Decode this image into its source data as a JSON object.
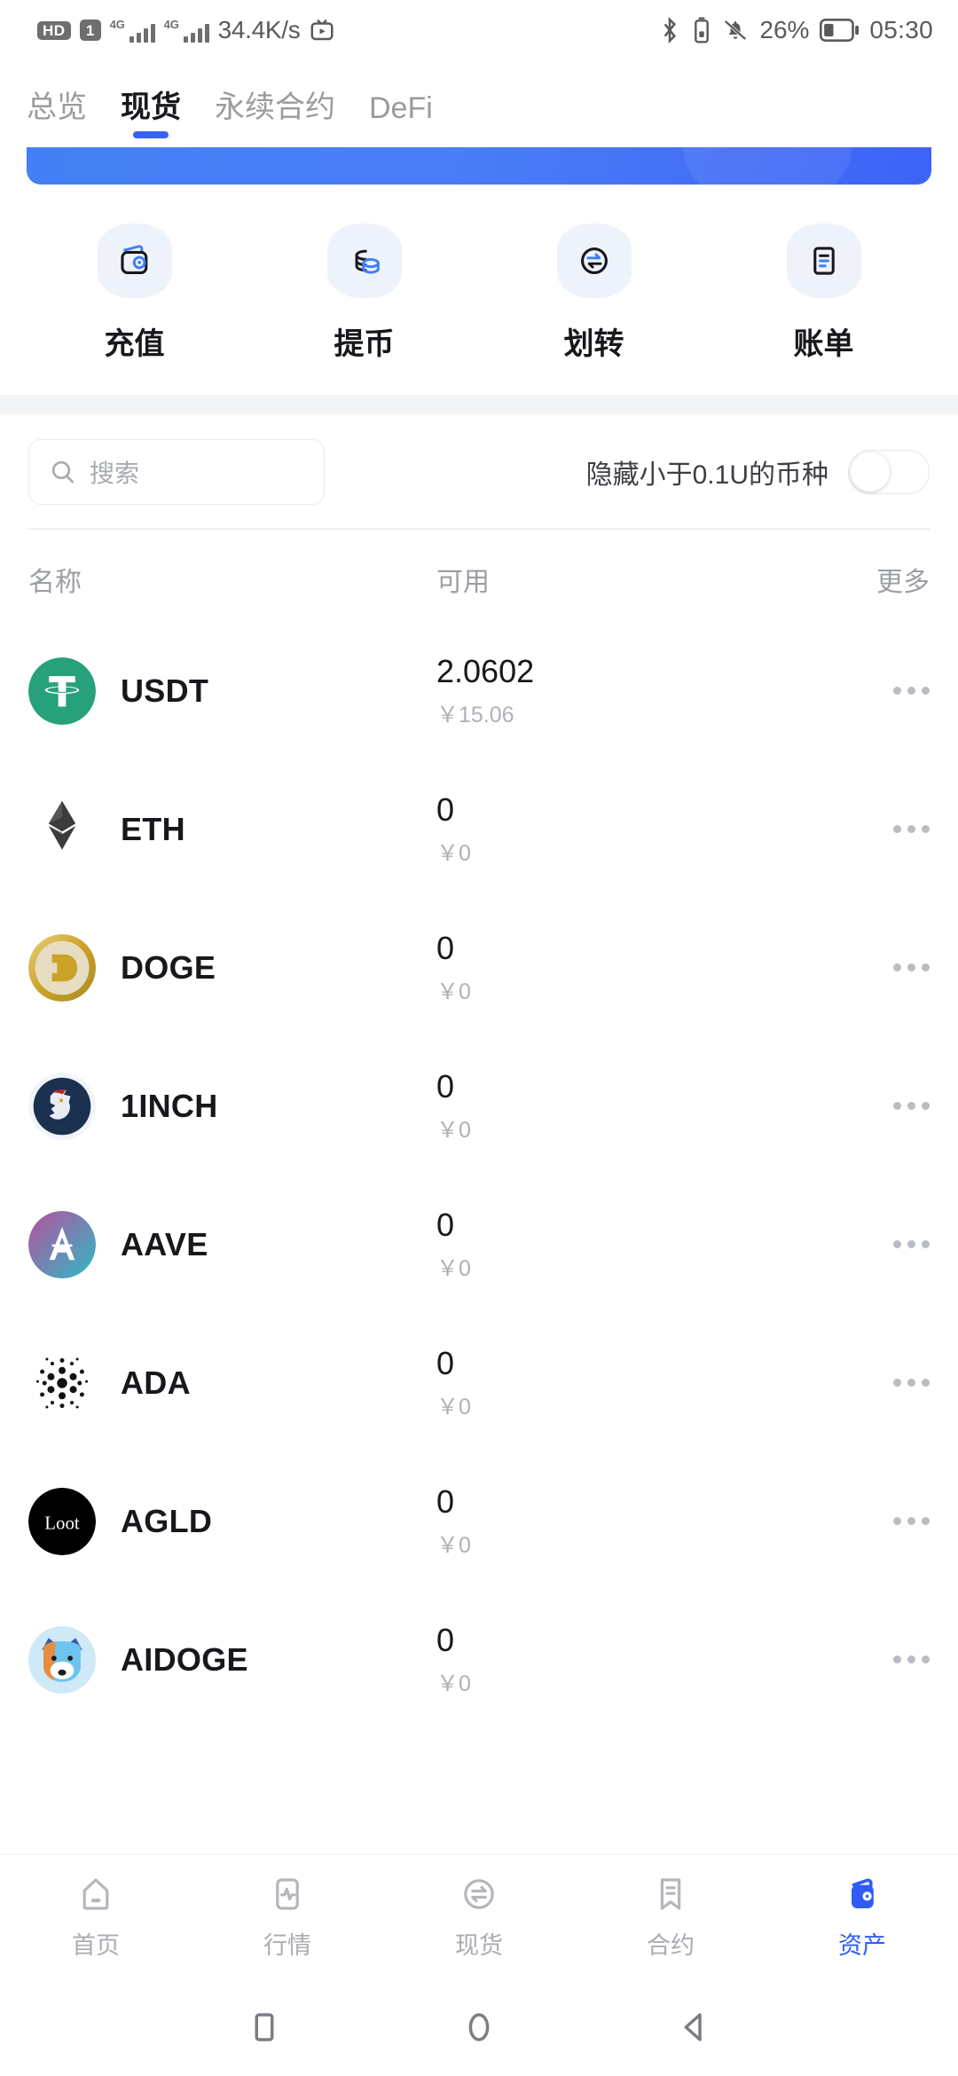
{
  "status_bar": {
    "hd_label": "HD",
    "sim_label": "1",
    "network_1": "4G",
    "network_2": "4G",
    "net_speed": "34.4K/s",
    "battery_percent": "26%",
    "clock": "05:30",
    "icons": [
      "hd-badge",
      "sim-badge",
      "signal-4g-icon",
      "signal-4g-icon",
      "tv-icon",
      "bluetooth-icon",
      "bluetooth-battery-icon",
      "mute-bell-icon",
      "battery-icon"
    ]
  },
  "top_tabs": [
    {
      "label": "总览",
      "active": false
    },
    {
      "label": "现货",
      "active": true
    },
    {
      "label": "永续合约",
      "active": false
    },
    {
      "label": "DeFi",
      "active": false
    }
  ],
  "actions": [
    {
      "label": "充值",
      "icon": "wallet-icon"
    },
    {
      "label": "提币",
      "icon": "coins-icon"
    },
    {
      "label": "划转",
      "icon": "transfer-icon"
    },
    {
      "label": "账单",
      "icon": "bill-icon"
    }
  ],
  "search": {
    "placeholder": "搜索",
    "icon": "search-icon"
  },
  "filter": {
    "label": "隐藏小于0.1U的币种",
    "enabled": false
  },
  "table": {
    "headers": {
      "name": "名称",
      "available": "可用",
      "more": "更多"
    },
    "rows": [
      {
        "symbol": "USDT",
        "amount": "2.0602",
        "fiat": "￥15.06"
      },
      {
        "symbol": "ETH",
        "amount": "0",
        "fiat": "￥0"
      },
      {
        "symbol": "DOGE",
        "amount": "0",
        "fiat": "￥0"
      },
      {
        "symbol": "1INCH",
        "amount": "0",
        "fiat": "￥0"
      },
      {
        "symbol": "AAVE",
        "amount": "0",
        "fiat": "￥0"
      },
      {
        "symbol": "ADA",
        "amount": "0",
        "fiat": "￥0"
      },
      {
        "symbol": "AGLD",
        "amount": "0",
        "fiat": "￥0"
      },
      {
        "symbol": "AIDOGE",
        "amount": "0",
        "fiat": "￥0"
      }
    ]
  },
  "bottom_nav": [
    {
      "label": "首页",
      "icon": "home-icon",
      "active": false
    },
    {
      "label": "行情",
      "icon": "market-icon",
      "active": false
    },
    {
      "label": "现货",
      "icon": "spot-icon",
      "active": false
    },
    {
      "label": "合约",
      "icon": "contract-icon",
      "active": false
    },
    {
      "label": "资产",
      "icon": "assets-icon",
      "active": true
    }
  ],
  "android_nav": [
    {
      "icon": "recents-square-icon"
    },
    {
      "icon": "home-circle-icon"
    },
    {
      "icon": "back-triangle-icon"
    }
  ],
  "colors": {
    "accent": "#3861fb",
    "active_nav": "#2f5cf6",
    "banner_start": "#4480f5",
    "banner_end": "#3d63f7",
    "muted_text": "#9b9ea4"
  }
}
